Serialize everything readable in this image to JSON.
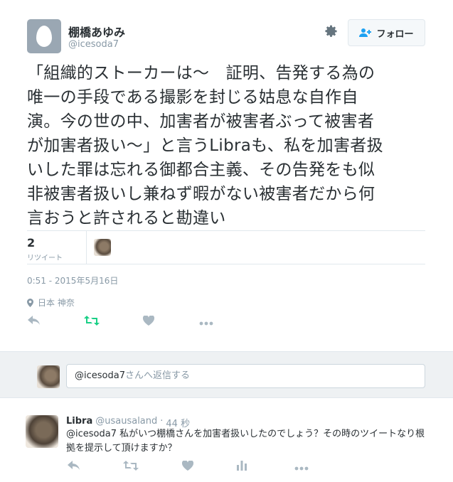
{
  "tweet": {
    "author_name": "棚橋あゆみ",
    "author_handle": "@icesoda7",
    "follow_label": "フォロー",
    "text": "「組織的ストーカーは～　証明、告発する為の\n唯一の手段である撮影を封じる姑息な自作自\n演。今の世の中、加害者が被害者ぶって被害者\nが加害者扱い～」と言うLibraも、私を加害者扱\nいした罪は忘れる御都合主義、その告発をも似\n非被害者扱いし兼ねず暇がない被害者だから何\n言おうと許されると勘違い",
    "retweet_count": "2",
    "retweet_label": "リツイート",
    "timestamp": "0:51 - 2015年5月16日",
    "location": "日本 神奈"
  },
  "reply_composer": {
    "mention": "@icesoda7",
    "placeholder_suffix": "さんへ返信する"
  },
  "reply": {
    "author_name": "Libra",
    "author_handle": "@usausaland",
    "separator": "·",
    "time": "44 秒",
    "text": "@icesoda7 私がいつ棚橋さんを加害者扱いしたのでしょう？その時のツイートなり根拠を提示して頂けますか？"
  },
  "icons": {
    "settings": "gear-icon",
    "follow": "add-user-icon",
    "reply": "reply-icon",
    "retweet": "retweet-icon",
    "like": "heart-icon",
    "more": "more-icon",
    "analytics": "bar-chart-icon",
    "location": "location-pin-icon"
  },
  "colors": {
    "retweet_active": "#19cf86",
    "muted": "#aab8c2",
    "meta_text": "#8899a6"
  }
}
